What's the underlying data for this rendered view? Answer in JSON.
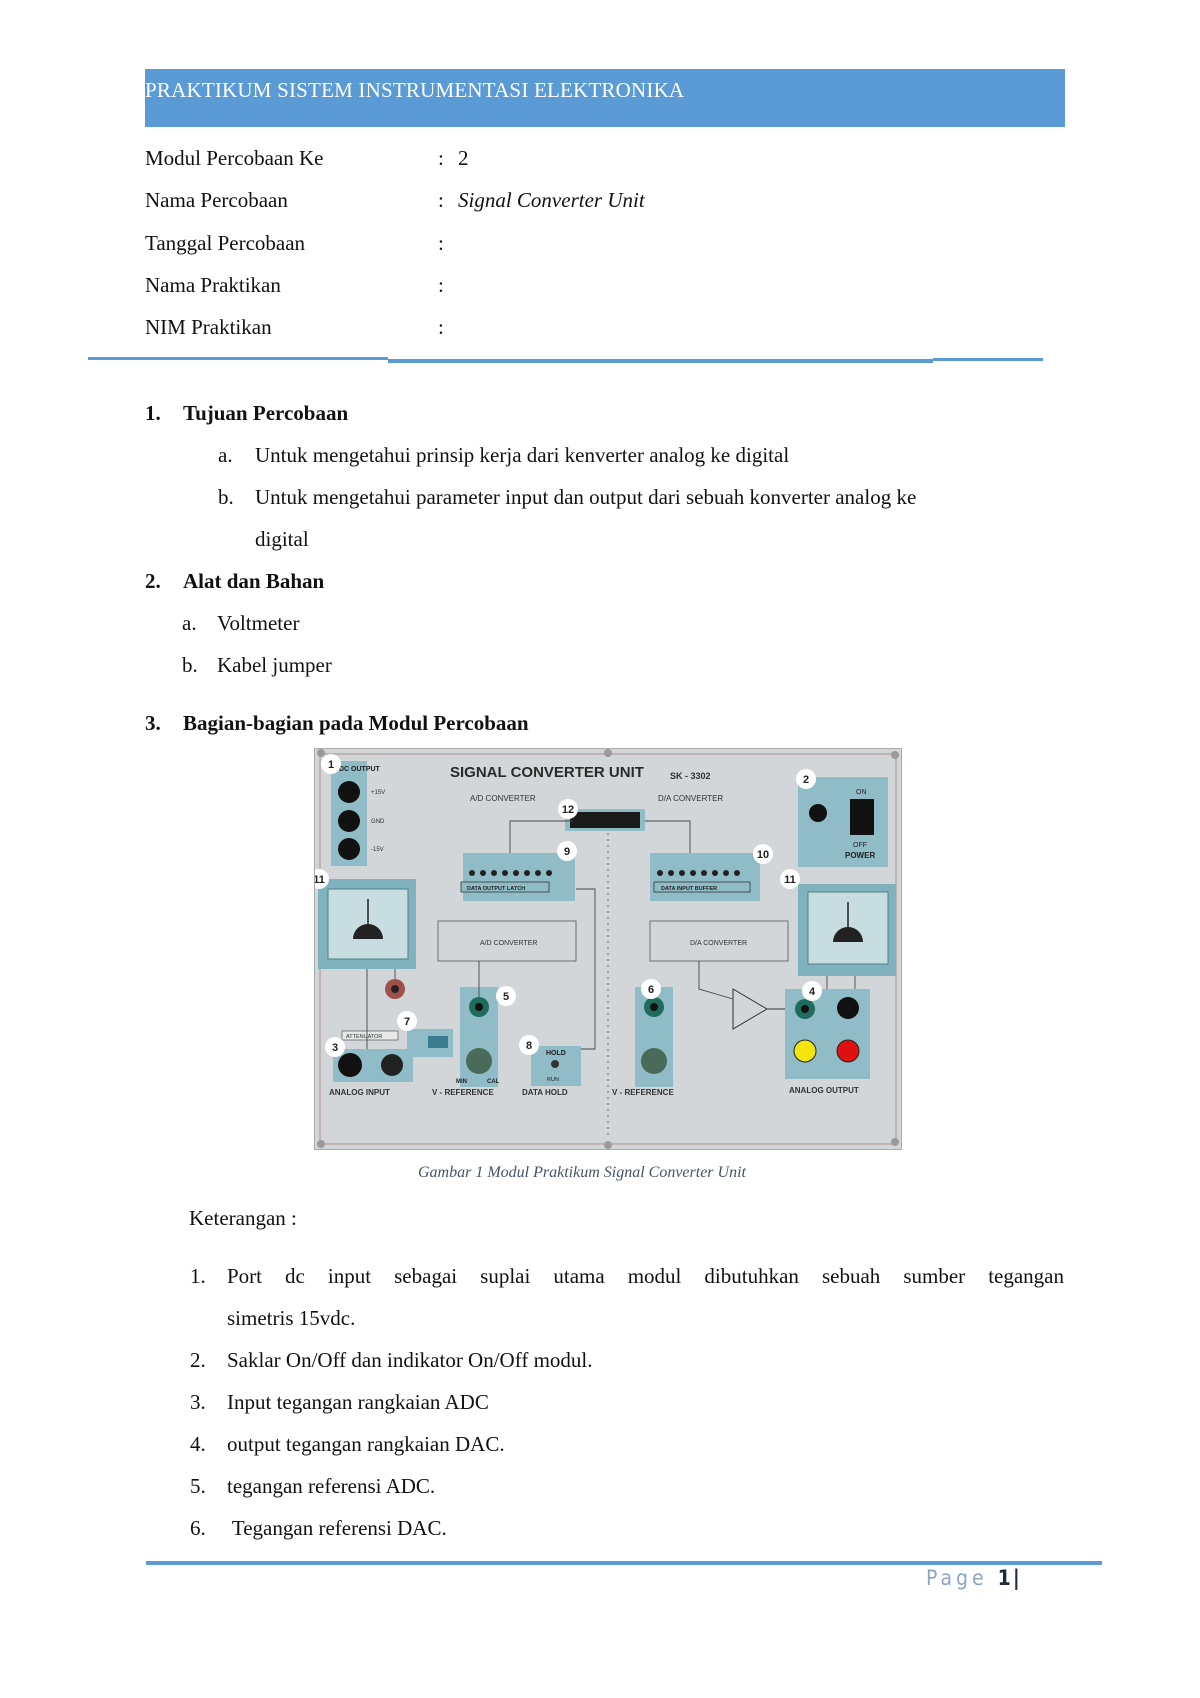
{
  "header": {
    "title": "PRAKTIKUM SISTEM INSTRUMENTASI ELEKTRONIKA"
  },
  "info": [
    {
      "label": "Modul Percobaan Ke",
      "sep": ":",
      "value": "2"
    },
    {
      "label": "Nama Percobaan",
      "sep": ":",
      "value": "Signal Converter Unit"
    },
    {
      "label": "Tanggal Percobaan",
      "sep": ":",
      "value": ""
    },
    {
      "label": "Nama Praktikan",
      "sep": ":",
      "value": ""
    },
    {
      "label": "NIM Praktikan",
      "sep": ":",
      "value": ""
    }
  ],
  "sections": [
    {
      "num": "1.",
      "title": "Tujuan Percobaan",
      "items": [
        {
          "marker": "a.",
          "text": "Untuk mengetahui prinsip kerja dari kenverter analog ke digital"
        },
        {
          "marker": "b.",
          "text": "Untuk mengetahui parameter input dan output dari sebuah konverter analog ke",
          "continuation": "digital"
        }
      ]
    },
    {
      "num": "2.",
      "title": "Alat dan Bahan",
      "items": [
        {
          "marker": "a.",
          "text": "Voltmeter"
        },
        {
          "marker": "b.",
          "text": "Kabel jumper"
        }
      ]
    },
    {
      "num": "3.",
      "title": "Bagian-bagian pada Modul Percobaan"
    }
  ],
  "figure": {
    "panel_title": "SIGNAL CONVERTER UNIT",
    "model": "SK - 3302",
    "ad_converter": "A/D CONVERTER",
    "da_converter": "D/A CONVERTER",
    "dc_output": "DC OUTPUT",
    "dc_pins": [
      "+15V",
      "GND",
      "-15V"
    ],
    "power_on": "ON",
    "power_off": "OFF",
    "power": "POWER",
    "data_output_latch": "DATA OUTPUT LATCH",
    "data_input_buffer": "DATA INPUT BUFFER",
    "attenuator": "ATTENUATOR",
    "analog_input": "ANALOG   INPUT",
    "v_reference": "V - REFERENCE",
    "data_hold": "DATA HOLD",
    "hold": "HOLD",
    "run": "RUN",
    "analog_output": "ANALOG OUTPUT",
    "min": "MIN",
    "cal": "CAL",
    "callouts": [
      "1",
      "2",
      "3",
      "4",
      "5",
      "6",
      "7",
      "8",
      "9",
      "10",
      "11",
      "11",
      "12"
    ],
    "colors": {
      "panel": "#d6d9da",
      "teal": "#8fbcc6",
      "yellow": "#f2e60e",
      "red": "#e01010"
    }
  },
  "caption": "Gambar 1 Modul Praktikum Signal Converter Unit",
  "keterangan": {
    "title": "Keterangan :",
    "items": [
      {
        "num": "1.",
        "text": "Port dc input sebagai suplai utama modul dibutuhkan sebuah sumber tegangan",
        "continuation": "simetris 15vdc."
      },
      {
        "num": "2.",
        "text": "Saklar On/Off dan indikator On/Off modul."
      },
      {
        "num": "3.",
        "text": "Input tegangan rangkaian ADC"
      },
      {
        "num": "4.",
        "text": "output tegangan rangkaian DAC."
      },
      {
        "num": "5.",
        "text": "tegangan referensi ADC."
      },
      {
        "num": "6.",
        "text": " Tegangan referensi DAC."
      }
    ]
  },
  "footer": {
    "page_word": "Page",
    "page_number": "1",
    "bar": "|"
  },
  "theme": {
    "accent": "#5b9bd5",
    "caption_color": "#44546a"
  }
}
